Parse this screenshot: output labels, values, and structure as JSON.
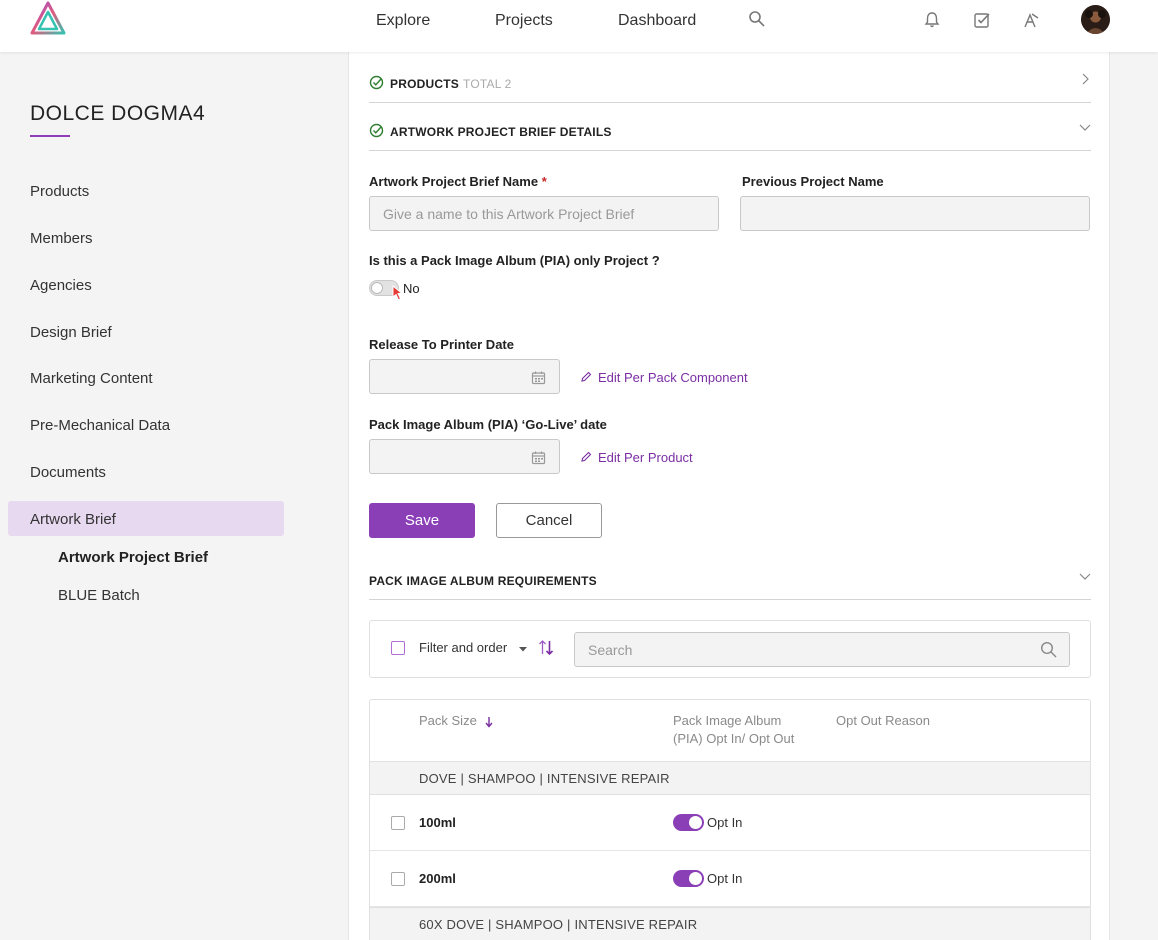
{
  "nav": {
    "links": [
      "Explore",
      "Projects",
      "Dashboard"
    ]
  },
  "sidebar": {
    "project_title": "DOLCE DOGMA4",
    "items": [
      "Products",
      "Members",
      "Agencies",
      "Design Brief",
      "Marketing Content",
      "Pre-Mechanical Data",
      "Documents",
      "Artwork Brief"
    ],
    "active_item": "Artwork Brief",
    "sub_items": [
      "Artwork Project Brief",
      "BLUE Batch"
    ]
  },
  "sections": {
    "products": {
      "label": "PRODUCTS",
      "total": "TOTAL 2"
    },
    "brief_details": {
      "label": "ARTWORK PROJECT BRIEF DETAILS"
    },
    "pia_requirements": {
      "label": "PACK IMAGE ALBUM REQUIREMENTS"
    }
  },
  "form": {
    "brief_name_label": "Artwork Project Brief Name",
    "brief_name_required": "*",
    "brief_name_placeholder": "Give a name to this Artwork Project Brief",
    "brief_name_value": "",
    "previous_name_label": "Previous Project Name",
    "previous_name_value": "",
    "pia_question": "Is this a Pack Image Album (PIA) only Project ?",
    "pia_toggle_value": "No",
    "release_date_label": "Release To Printer Date",
    "release_date_value": "",
    "release_edit_link": "Edit Per Pack Component",
    "golive_label": "Pack Image Album (PIA) ‘Go-Live’ date",
    "golive_value": "",
    "golive_edit_link": "Edit Per Product",
    "save_label": "Save",
    "cancel_label": "Cancel"
  },
  "filter": {
    "label": "Filter and order",
    "search_placeholder": "Search"
  },
  "table": {
    "columns": [
      "Pack Size",
      "Pack Image Album (PIA) Opt In/ Opt Out",
      "Opt Out Reason"
    ],
    "col2_line1": "Pack Image Album",
    "col2_line2": "(PIA) Opt In/ Opt Out",
    "groups": [
      {
        "name": "DOVE | SHAMPOO | INTENSIVE REPAIR",
        "rows": [
          {
            "size": "100ml",
            "status": "Opt In"
          },
          {
            "size": "200ml",
            "status": "Opt In"
          }
        ]
      },
      {
        "name": "60X DOVE | SHAMPOO | INTENSIVE REPAIR",
        "rows": []
      }
    ]
  },
  "colors": {
    "accent": "#8b3fb7",
    "active_bg": "#e7d9ef",
    "success": "#2e7d32"
  }
}
